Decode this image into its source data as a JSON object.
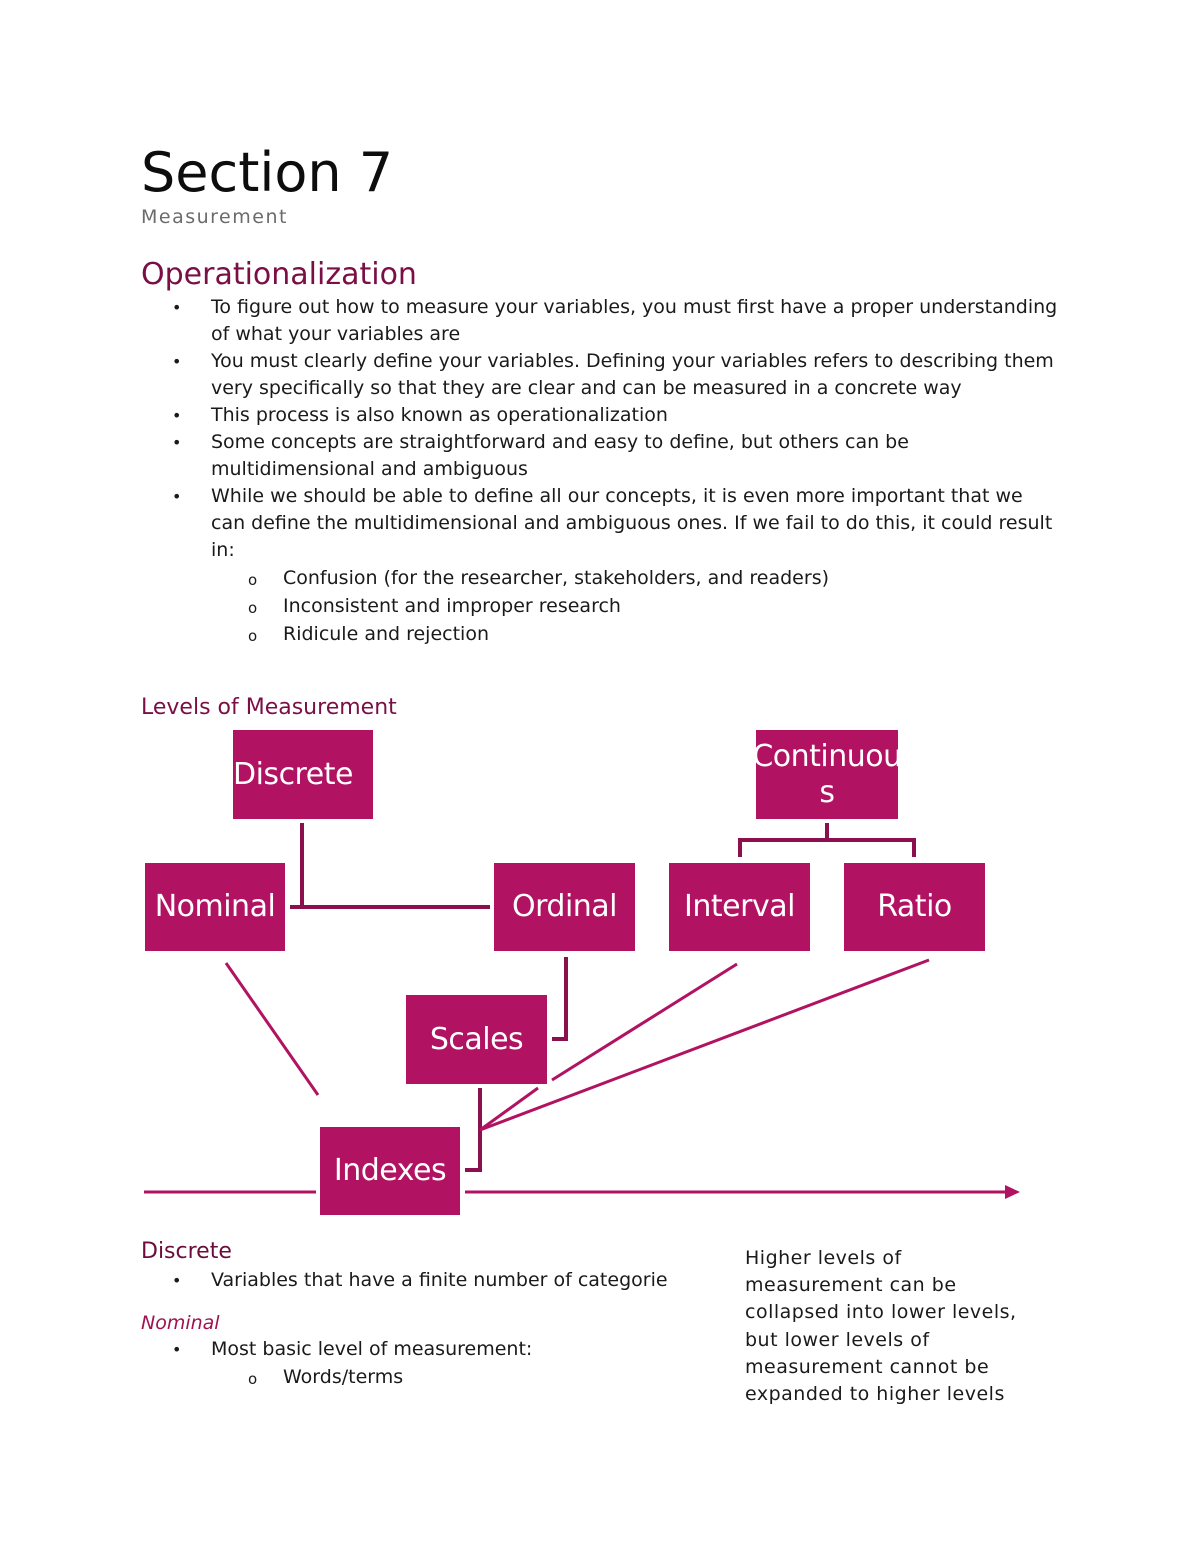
{
  "document": {
    "title": "Section 7",
    "subtitle": "Measurement",
    "heading_operationalization": "Operationalization",
    "operationalization_bullets": [
      "To figure out how to measure your variables, you must first have a proper understanding of what your variables are",
      "You must clearly define your variables. Defining your variables refers to describing them very specifically so that they are clear and can be measured in a concrete way",
      "This process is also known as operationalization",
      "Some concepts are straightforward and easy to define, but others can be multidimensional and ambiguous",
      "While we should be able to define all our concepts, it is even more important that we can define the multidimensional and ambiguous ones. If we fail to do this, it could result in:"
    ],
    "operationalization_subbullets": [
      "Confusion (for the researcher, stakeholders, and readers)",
      "Inconsistent and improper research",
      "Ridicule and rejection"
    ],
    "heading_levels": "Levels of Measurement",
    "diagram": {
      "accent_color": "#b11261",
      "line_color": "#8c0f4e",
      "boxes": {
        "discrete": "Discrete",
        "continuous_line1": "Continuou",
        "continuous_line2": "s",
        "nominal": "Nominal",
        "ordinal": "Ordinal",
        "interval": "Interval",
        "ratio": "Ratio",
        "scales": "Scales",
        "indexes": "Indexes"
      }
    },
    "heading_discrete": "Discrete",
    "discrete_bullets": [
      "Variables that have a finite number of categorie"
    ],
    "heading_nominal": "Nominal",
    "nominal_bullets": [
      "Most basic level of measurement:"
    ],
    "nominal_subbullets": [
      "Words/terms"
    ],
    "sidenote": "Higher levels of measurement can be collapsed into lower levels, but lower levels of measurement cannot be expanded to higher levels",
    "bullet_glyph": "•",
    "subbullet_glyph": "o"
  }
}
